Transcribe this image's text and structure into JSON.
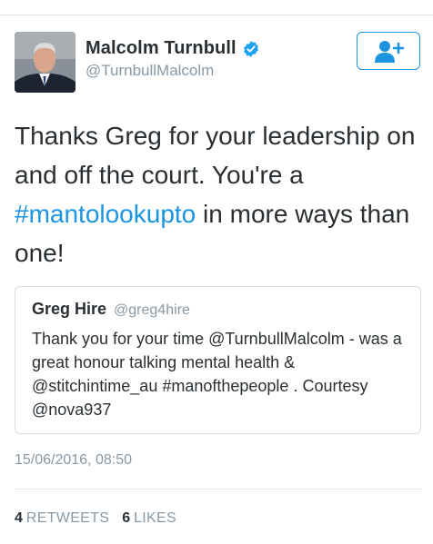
{
  "tweet": {
    "author_name": "Malcolm Turnbull",
    "author_handle": "@TurnbullMalcolm",
    "text_before": "Thanks Greg for your leadership on and off the court. You're a ",
    "hashtag": "#mantolookupto",
    "text_after": " in more ways than one!",
    "timestamp": "15/06/2016, 08:50"
  },
  "quoted": {
    "name": "Greg Hire",
    "handle": "@greg4hire",
    "text": "Thank you for your time @TurnbullMalcolm - was a great honour talking mental health & @stitchintime_au #manofthepeople . Courtesy @nova937"
  },
  "stats": {
    "retweets_count": "4",
    "retweets_label": "RETWEETS",
    "likes_count": "6",
    "likes_label": "LIKES"
  },
  "colors": {
    "accent": "#1b95e0",
    "secondary_text": "#8899a6",
    "primary_text": "#292f33"
  },
  "icons": {
    "verified": "verified-badge-icon",
    "follow": "add-user-icon"
  }
}
